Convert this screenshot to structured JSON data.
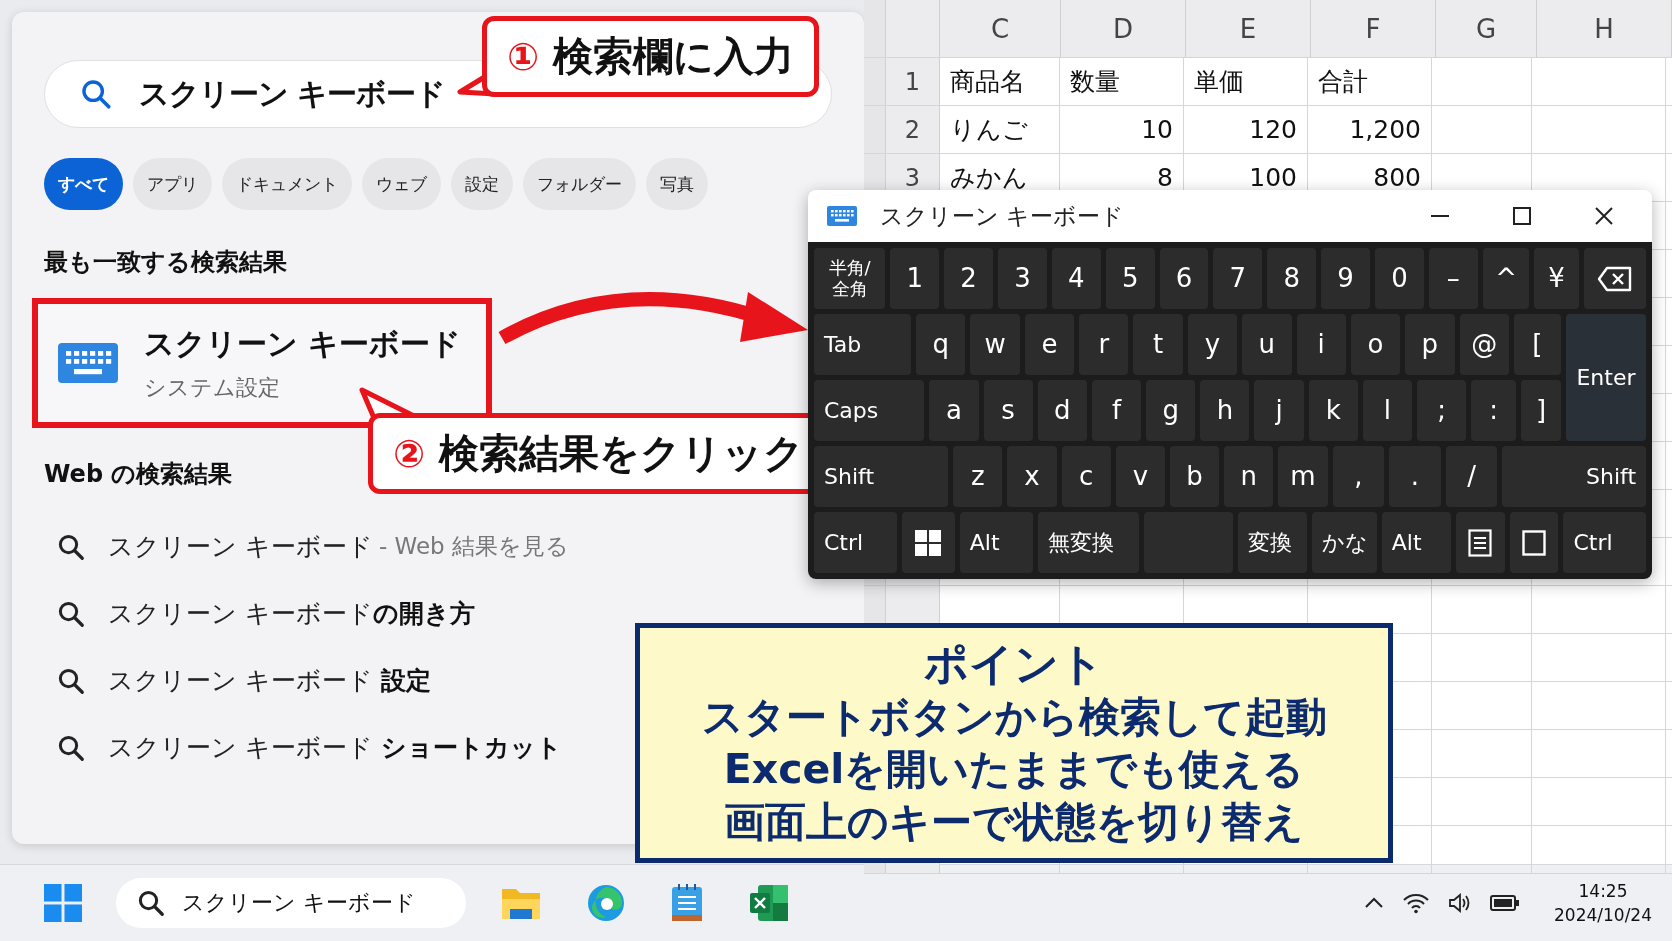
{
  "search_panel": {
    "search_field": {
      "value": "スクリーン キーボード"
    },
    "filters": [
      {
        "label": "すべて",
        "selected": true
      },
      {
        "label": "アプリ",
        "selected": false
      },
      {
        "label": "ドキュメント",
        "selected": false
      },
      {
        "label": "ウェブ",
        "selected": false
      },
      {
        "label": "設定",
        "selected": false
      },
      {
        "label": "フォルダー",
        "selected": false
      },
      {
        "label": "写真",
        "selected": false
      }
    ],
    "best_match": {
      "heading": "最も一致する検索結果",
      "title": "スクリーン キーボード",
      "subtitle": "システム設定"
    },
    "web": {
      "heading": "Web の検索結果",
      "results": [
        {
          "text": "スクリーン キーボード",
          "hint": "- Web 結果を見る"
        },
        {
          "text": "スクリーン キーボード**の開き方**"
        },
        {
          "text": "スクリーン キーボード **設定**"
        },
        {
          "text": "スクリーン キーボード **ショートカット**"
        }
      ]
    }
  },
  "callouts": [
    {
      "number": "①",
      "text": "検索欄に入力"
    },
    {
      "number": "②",
      "text": "検索結果をクリック"
    }
  ],
  "spreadsheet": {
    "columns": [
      "C",
      "D",
      "E",
      "F",
      "G",
      "H"
    ],
    "rows": [
      {
        "number": "1",
        "name": "商品名",
        "values": [
          "数量",
          "単価",
          "合計"
        ],
        "kind": "header"
      },
      {
        "number": "2",
        "name": "りんご",
        "values": [
          "10",
          "120",
          "1,200"
        ],
        "kind": "data"
      },
      {
        "number": "3",
        "name": "みかん",
        "values": [
          "8",
          "100",
          "800"
        ],
        "kind": "data"
      }
    ]
  },
  "keyboard_window": {
    "title": "スクリーン キーボード",
    "rows": [
      [
        {
          "label": "半角/\n全角",
          "kind": "small"
        },
        {
          "label": "1",
          "kind": "char"
        },
        {
          "label": "2",
          "kind": "char"
        },
        {
          "label": "3",
          "kind": "char"
        },
        {
          "label": "4",
          "kind": "char"
        },
        {
          "label": "5",
          "kind": "char"
        },
        {
          "label": "6",
          "kind": "char"
        },
        {
          "label": "7",
          "kind": "char"
        },
        {
          "label": "8",
          "kind": "char"
        },
        {
          "label": "9",
          "kind": "char"
        },
        {
          "label": "0",
          "kind": "char"
        },
        {
          "label": "–",
          "kind": "char"
        },
        {
          "label": "^",
          "kind": "char"
        },
        {
          "label": "¥",
          "kind": "char"
        },
        {
          "kind": "backspace"
        }
      ],
      [
        {
          "label": "Tab",
          "kind": "word"
        },
        {
          "label": "q",
          "kind": "char"
        },
        {
          "label": "w",
          "kind": "char"
        },
        {
          "label": "e",
          "kind": "char"
        },
        {
          "label": "r",
          "kind": "char"
        },
        {
          "label": "t",
          "kind": "char"
        },
        {
          "label": "y",
          "kind": "char"
        },
        {
          "label": "u",
          "kind": "char"
        },
        {
          "label": "i",
          "kind": "char"
        },
        {
          "label": "o",
          "kind": "char"
        },
        {
          "label": "p",
          "kind": "char"
        },
        {
          "label": "@",
          "kind": "char"
        },
        {
          "label": "[",
          "kind": "char"
        },
        {
          "label": "Enter",
          "kind": "enter"
        }
      ],
      [
        {
          "label": "Caps",
          "kind": "word"
        },
        {
          "label": "a",
          "kind": "char"
        },
        {
          "label": "s",
          "kind": "char"
        },
        {
          "label": "d",
          "kind": "char"
        },
        {
          "label": "f",
          "kind": "char"
        },
        {
          "label": "g",
          "kind": "char"
        },
        {
          "label": "h",
          "kind": "char"
        },
        {
          "label": "j",
          "kind": "char"
        },
        {
          "label": "k",
          "kind": "char"
        },
        {
          "label": "l",
          "kind": "char"
        },
        {
          "label": ";",
          "kind": "char"
        },
        {
          "label": ":",
          "kind": "char"
        },
        {
          "label": "]",
          "kind": "char"
        }
      ],
      [
        {
          "label": "Shift",
          "kind": "word"
        },
        {
          "label": "z",
          "kind": "char"
        },
        {
          "label": "x",
          "kind": "char"
        },
        {
          "label": "c",
          "kind": "char"
        },
        {
          "label": "v",
          "kind": "char"
        },
        {
          "label": "b",
          "kind": "char"
        },
        {
          "label": "n",
          "kind": "char"
        },
        {
          "label": "m",
          "kind": "char"
        },
        {
          "label": ",",
          "kind": "char"
        },
        {
          "label": ".",
          "kind": "char"
        },
        {
          "label": "/",
          "kind": "char"
        },
        {
          "label": "Shift",
          "kind": "word-right"
        }
      ],
      [
        {
          "label": "Ctrl",
          "kind": "word"
        },
        {
          "kind": "windows"
        },
        {
          "label": "Alt",
          "kind": "word"
        },
        {
          "label": "無変換",
          "kind": "word"
        },
        {
          "kind": "space"
        },
        {
          "label": "変換",
          "kind": "word"
        },
        {
          "label": "かな",
          "kind": "word"
        },
        {
          "label": "Alt",
          "kind": "word"
        },
        {
          "kind": "menu"
        },
        {
          "kind": "square"
        },
        {
          "label": "Ctrl",
          "kind": "word"
        }
      ]
    ]
  },
  "point": {
    "title": "ポイント",
    "lines": [
      "スタートボタンから検索して起動",
      "Excelを開いたままでも使える",
      "画面上のキーで状態を切り替え"
    ]
  },
  "taskbar": {
    "search": {
      "value": "スクリーン キーボード"
    },
    "clock": {
      "time": "14:25",
      "date": "2024/10/24"
    }
  }
}
